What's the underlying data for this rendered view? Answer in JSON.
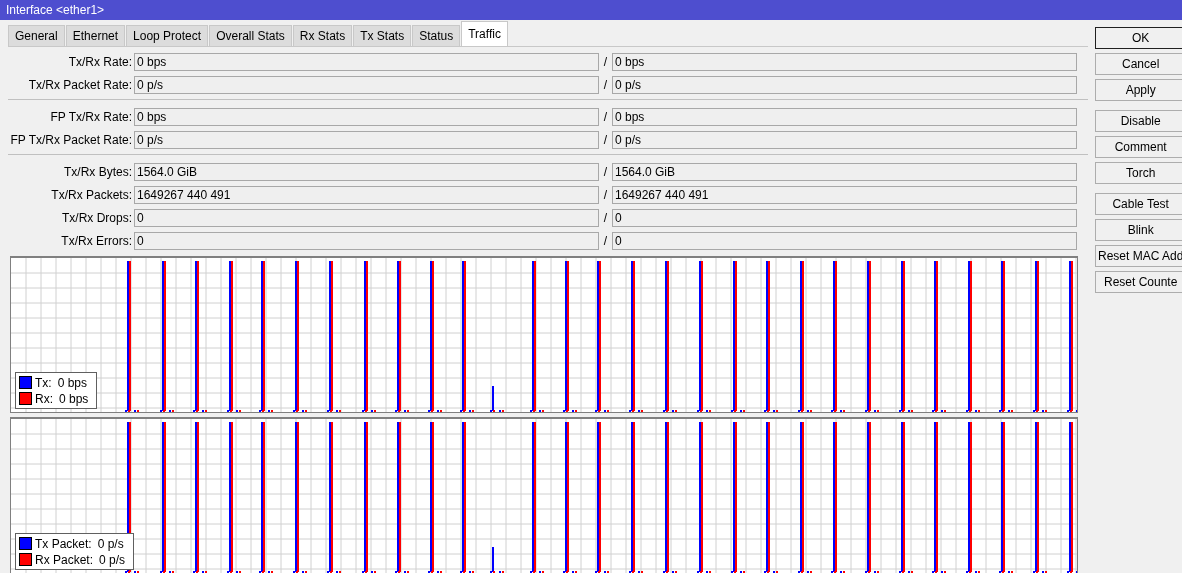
{
  "window": {
    "title": "Interface <ether1>"
  },
  "tabs": [
    {
      "label": "General",
      "selected": false
    },
    {
      "label": "Ethernet",
      "selected": false
    },
    {
      "label": "Loop Protect",
      "selected": false
    },
    {
      "label": "Overall Stats",
      "selected": false
    },
    {
      "label": "Rx Stats",
      "selected": false
    },
    {
      "label": "Tx Stats",
      "selected": false
    },
    {
      "label": "Status",
      "selected": false
    },
    {
      "label": "Traffic",
      "selected": true
    }
  ],
  "field_groups": [
    [
      {
        "label": "Tx/Rx Rate:",
        "tx": "0 bps",
        "separator": "/",
        "rx": "0 bps"
      },
      {
        "label": "Tx/Rx Packet Rate:",
        "tx": "0 p/s",
        "separator": "/",
        "rx": "0 p/s"
      }
    ],
    [
      {
        "label": "FP Tx/Rx Rate:",
        "tx": "0 bps",
        "separator": "/",
        "rx": "0 bps"
      },
      {
        "label": "FP Tx/Rx Packet Rate:",
        "tx": "0 p/s",
        "separator": "/",
        "rx": "0 p/s"
      }
    ],
    [
      {
        "label": "Tx/Rx Bytes:",
        "tx": "1564.0 GiB",
        "separator": "/",
        "rx": "1564.0 GiB"
      },
      {
        "label": "Tx/Rx Packets:",
        "tx": "1649267 440 491",
        "separator": "/",
        "rx": "1649267 440 491"
      },
      {
        "label": "Tx/Rx Drops:",
        "tx": "0",
        "separator": "/",
        "rx": "0"
      },
      {
        "label": "Tx/Rx Errors:",
        "tx": "0",
        "separator": "/",
        "rx": "0"
      }
    ]
  ],
  "graphs": [
    {
      "legend": [
        {
          "label": "Tx:",
          "value": "0 bps",
          "color": "#0000ff"
        },
        {
          "label": "Rx:",
          "value": "0 bps",
          "color": "#ff0000"
        }
      ]
    },
    {
      "legend": [
        {
          "label": "Tx Packet:",
          "value": "0 p/s",
          "color": "#0000ff"
        },
        {
          "label": "Rx Packet:",
          "value": "0 p/s",
          "color": "#ff0000"
        }
      ]
    }
  ],
  "buttons": [
    {
      "label": "OK",
      "default": true
    },
    {
      "label": "Cancel",
      "default": false
    },
    {
      "label": "Apply",
      "default": false
    },
    {
      "label": "Disable",
      "default": false
    },
    {
      "label": "Comment",
      "default": false
    },
    {
      "label": "Torch",
      "default": false
    },
    {
      "label": "Cable Test",
      "default": false
    },
    {
      "label": "Blink",
      "default": false
    },
    {
      "label": "Reset MAC Add",
      "default": false
    },
    {
      "label": "Reset Counte",
      "default": false
    }
  ]
}
